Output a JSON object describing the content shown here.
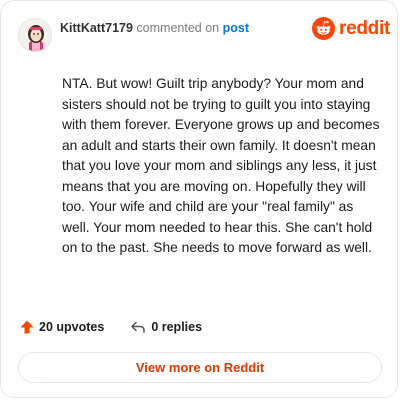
{
  "comment": {
    "author": "KittKatt7179",
    "action_text": "commented on",
    "post_link": "post",
    "body": "NTA. But wow! Guilt trip anybody? Your mom and sisters should not be trying to guilt you into staying with them forever. Everyone grows up and becomes an adult and starts their own family. It doesn't mean that you love your mom and siblings any less, it just means that you are moving on. Hopefully they will too. Your wife and child are your \"real family\" as well. Your mom needed to hear this. She can't hold on to the past. She needs to move forward as well."
  },
  "brand": {
    "name": "reddit",
    "icon": "reddit-snoo-icon",
    "color": "#ff4500"
  },
  "footer": {
    "upvotes_label": "20 upvotes",
    "upvote_icon": "upvote-arrow-icon",
    "upvote_color": "#ff4500",
    "replies_label": "0 replies",
    "reply_icon": "reply-arrow-icon"
  },
  "cta": {
    "view_more_label": "View more on Reddit",
    "color": "#d93a00"
  },
  "colors": {
    "link": "#0079d3",
    "muted": "#7c7c7c",
    "border": "#e3e6e8"
  }
}
